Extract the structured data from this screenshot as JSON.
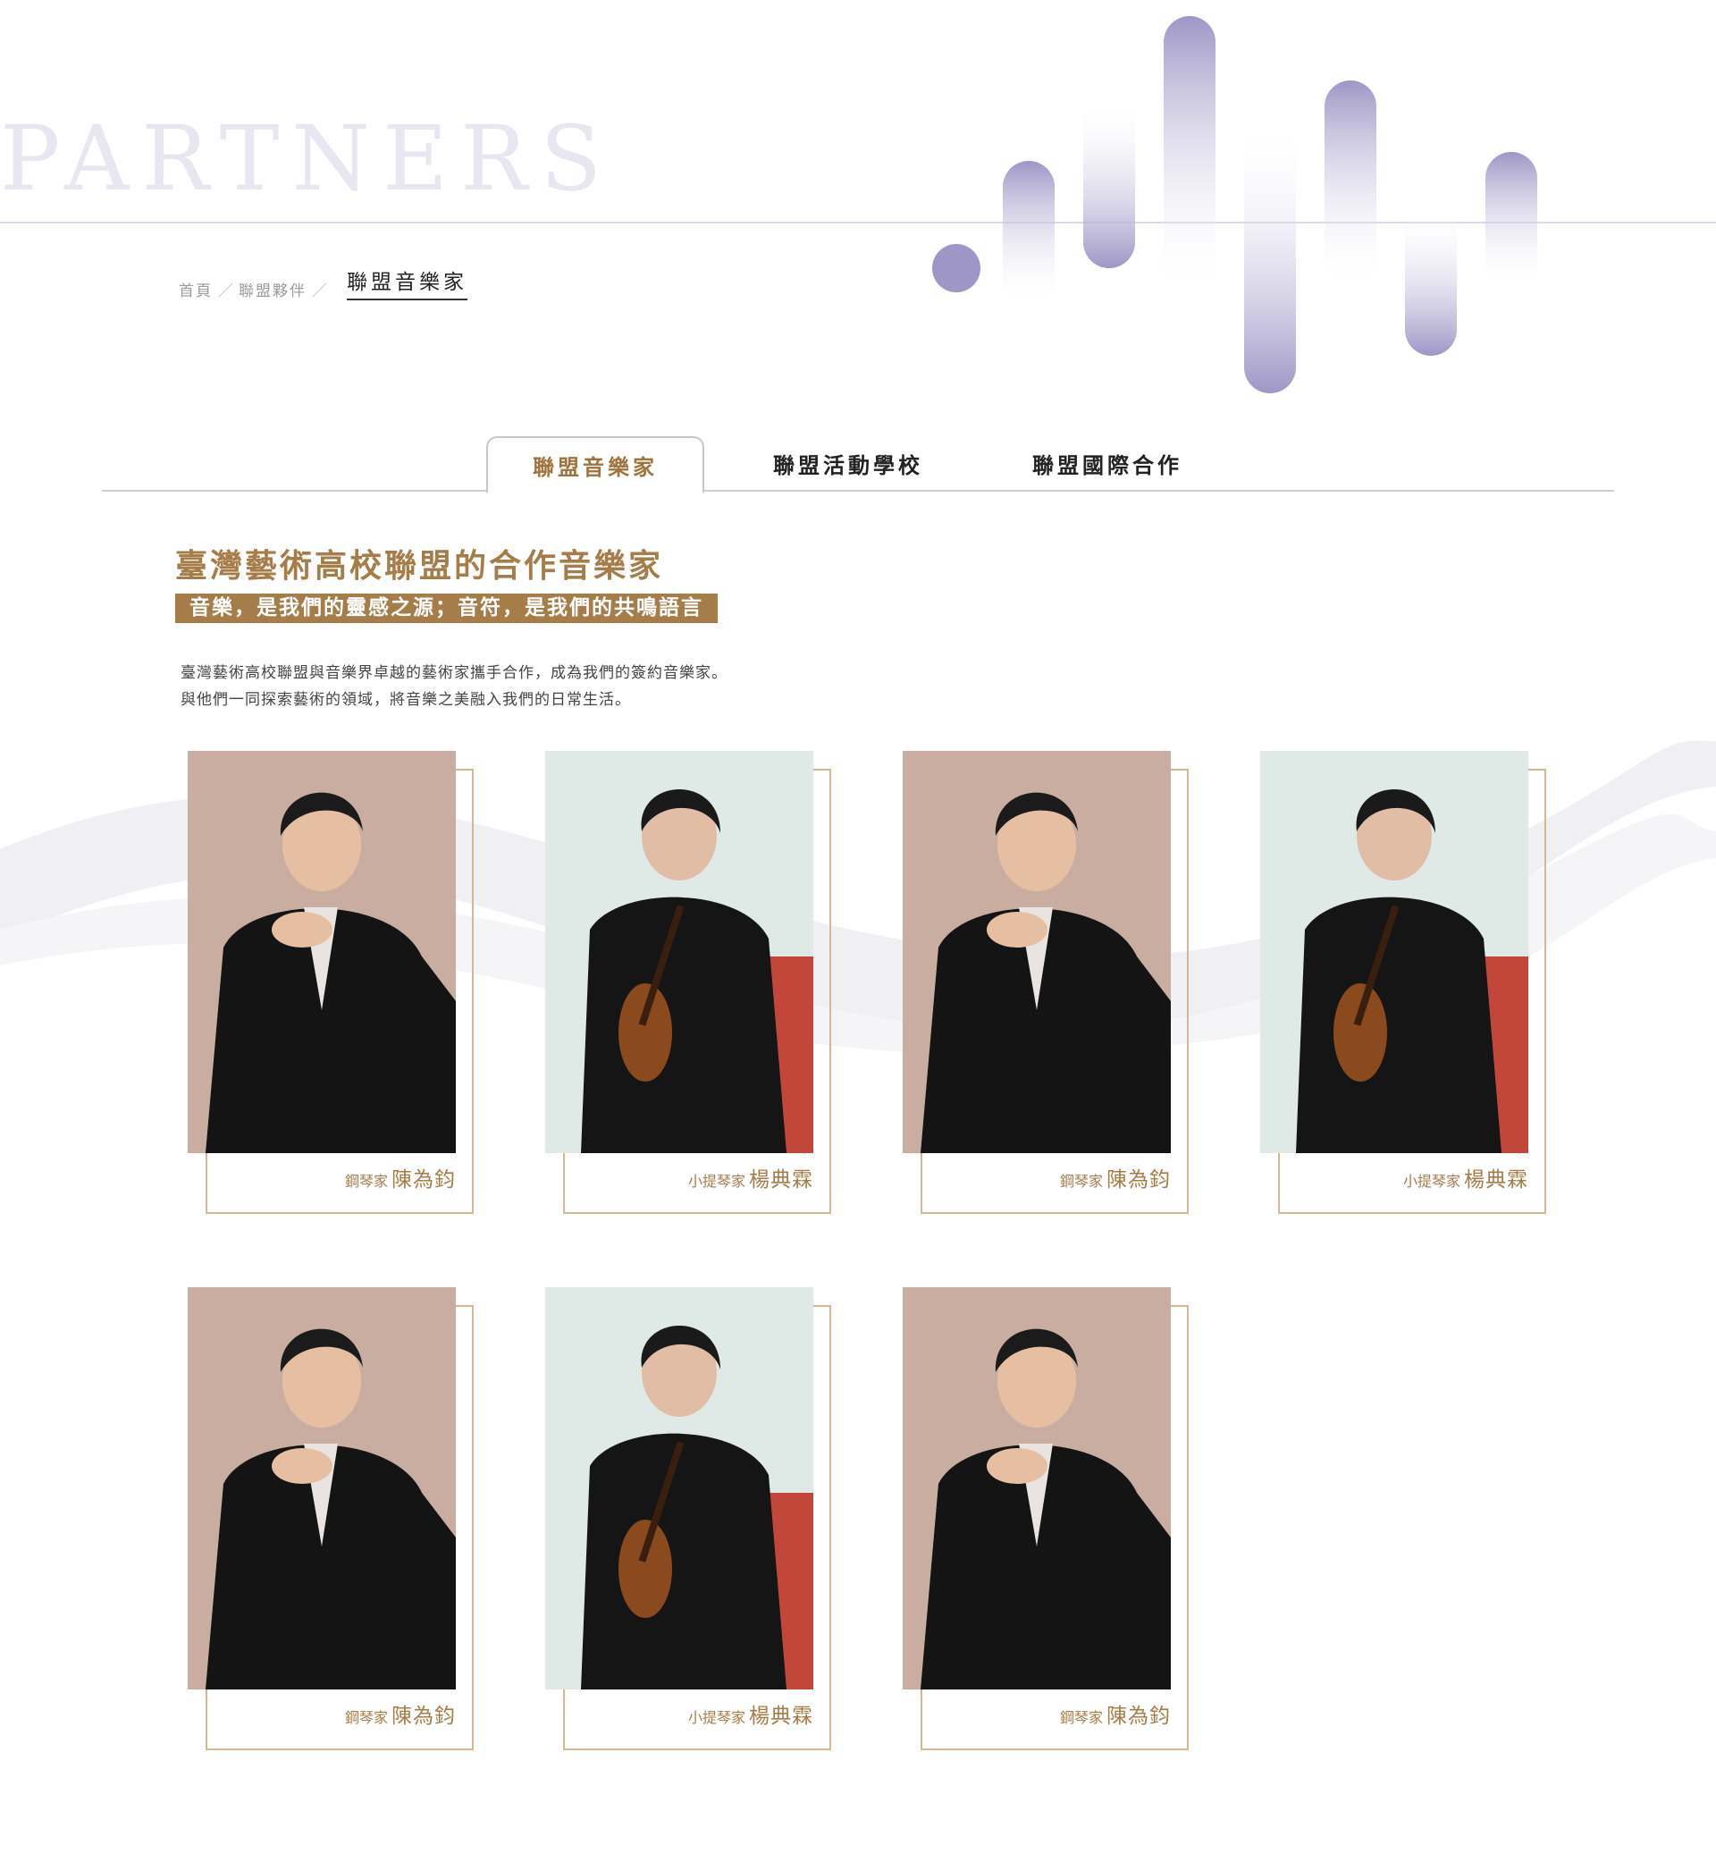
{
  "hero": {
    "title": "PARTNERS"
  },
  "breadcrumb": {
    "items": [
      "首頁",
      "聯盟夥伴"
    ],
    "separator": "／",
    "current": "聯盟音樂家"
  },
  "tabs": [
    {
      "label": "聯盟音樂家",
      "active": true
    },
    {
      "label": "聯盟活動學校",
      "active": false
    },
    {
      "label": "聯盟國際合作",
      "active": false
    }
  ],
  "section": {
    "title": "臺灣藝術高校聯盟的合作音樂家",
    "tagline": "音樂，是我們的靈感之源；音符，是我們的共鳴語言",
    "intro_line1": "臺灣藝術高校聯盟與音樂界卓越的藝術家攜手合作，成為我們的簽約音樂家。",
    "intro_line2": "與他們一同探索藝術的領域，將音樂之美融入我們的日常生活。"
  },
  "musicians": [
    {
      "role": "鋼琴家",
      "name": "陳為鈞",
      "photo": "pianist"
    },
    {
      "role": "小提琴家",
      "name": "楊典霖",
      "photo": "violinist"
    },
    {
      "role": "鋼琴家",
      "name": "陳為鈞",
      "photo": "pianist"
    },
    {
      "role": "小提琴家",
      "name": "楊典霖",
      "photo": "violinist"
    },
    {
      "role": "鋼琴家",
      "name": "陳為鈞",
      "photo": "pianist"
    },
    {
      "role": "小提琴家",
      "name": "楊典霖",
      "photo": "violinist"
    },
    {
      "role": "鋼琴家",
      "name": "陳為鈞",
      "photo": "pianist"
    }
  ],
  "colors": {
    "accent": "#a67c48",
    "frame": "#d2b893",
    "wave": "#9e96c6",
    "hero_text": "#e8e6f1"
  }
}
